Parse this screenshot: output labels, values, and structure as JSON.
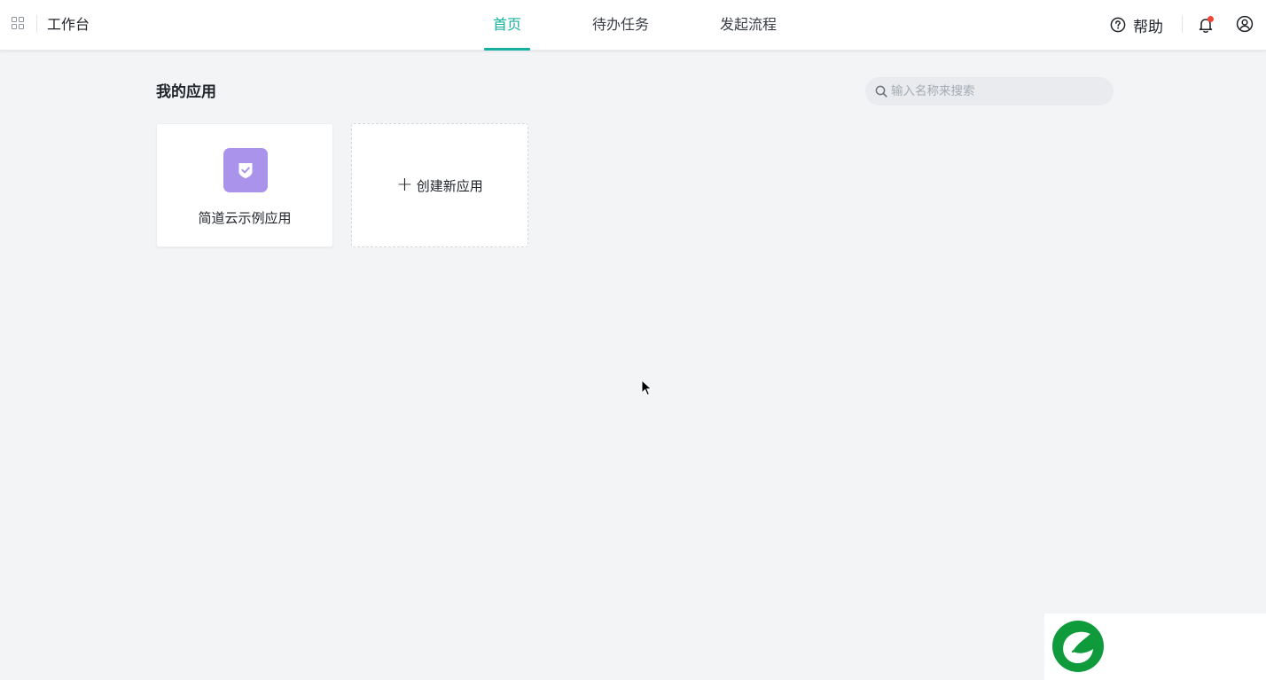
{
  "header": {
    "apps_icon": "grid-icon",
    "brand": "工作台",
    "nav": [
      {
        "label": "首页",
        "active": true
      },
      {
        "label": "待办任务",
        "active": false
      },
      {
        "label": "发起流程",
        "active": false
      }
    ],
    "help_label": "帮助",
    "help_icon": "question-circle-icon",
    "bell_icon": "bell-icon",
    "user_icon": "user-circle-icon",
    "has_unread_notification": true
  },
  "main": {
    "section_title": "我的应用",
    "search": {
      "placeholder": "输入名称来搜索",
      "value": "",
      "icon": "search-icon"
    },
    "apps": [
      {
        "name": "简道云示例应用",
        "icon": "shield-check-icon",
        "icon_color": "#a993eb"
      }
    ],
    "create_label": "创建新应用"
  },
  "theme": {
    "accent": "#16b0a0",
    "notification_dot": "#f04438",
    "logo_color": "#0f9a3c"
  }
}
